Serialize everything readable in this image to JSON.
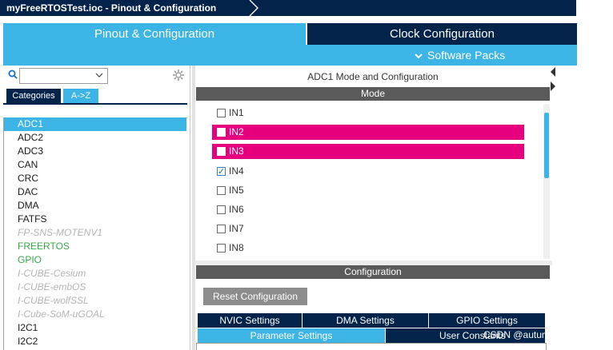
{
  "breadcrumb": {
    "text": "myFreeRTOSTest.ioc - Pinout & Configuration"
  },
  "tabs": {
    "pinout": "Pinout & Configuration",
    "clock": "Clock Configuration",
    "software_packs": "Software Packs"
  },
  "left": {
    "search": {
      "value": "",
      "placeholder": ""
    },
    "view_buttons": {
      "categories": "Categories",
      "az": "A->Z"
    },
    "items": [
      {
        "label": "ADC1",
        "state": "selected"
      },
      {
        "label": "ADC2",
        "state": "normal"
      },
      {
        "label": "ADC3",
        "state": "normal"
      },
      {
        "label": "CAN",
        "state": "normal"
      },
      {
        "label": "CRC",
        "state": "normal"
      },
      {
        "label": "DAC",
        "state": "normal"
      },
      {
        "label": "DMA",
        "state": "normal"
      },
      {
        "label": "FATFS",
        "state": "normal"
      },
      {
        "label": "FP-SNS-MOTENV1",
        "state": "disabled"
      },
      {
        "label": "FREERTOS",
        "state": "enabled"
      },
      {
        "label": "GPIO",
        "state": "enabled"
      },
      {
        "label": "I-CUBE-Cesium",
        "state": "disabled"
      },
      {
        "label": "I-CUBE-embOS",
        "state": "disabled"
      },
      {
        "label": "I-CUBE-wolfSSL",
        "state": "disabled"
      },
      {
        "label": "I-Cube-SoM-uGOAL",
        "state": "disabled"
      },
      {
        "label": "I2C1",
        "state": "normal"
      },
      {
        "label": "I2C2",
        "state": "normal"
      }
    ]
  },
  "mode": {
    "title": "ADC1 Mode and Configuration",
    "section": "Mode",
    "inputs": [
      {
        "label": "IN1",
        "checked": false,
        "highlighted": false
      },
      {
        "label": "IN2",
        "checked": false,
        "highlighted": true
      },
      {
        "label": "IN3",
        "checked": false,
        "highlighted": true
      },
      {
        "label": "IN4",
        "checked": true,
        "highlighted": false
      },
      {
        "label": "IN5",
        "checked": false,
        "highlighted": false
      },
      {
        "label": "IN6",
        "checked": false,
        "highlighted": false
      },
      {
        "label": "IN7",
        "checked": false,
        "highlighted": false
      },
      {
        "label": "IN8",
        "checked": false,
        "highlighted": false
      }
    ]
  },
  "config": {
    "section": "Configuration",
    "reset_label": "Reset Configuration",
    "tabs_row1": [
      "NVIC Settings",
      "DMA Settings",
      "GPIO Settings"
    ],
    "tabs_row2": [
      "Parameter Settings",
      "User Constants"
    ]
  },
  "watermark": "CSDN @autumn_qyh",
  "colors": {
    "navy": "#03234b",
    "st_blue": "#3cb4e6",
    "pink_highlight": "#e6007e",
    "enabled_green": "#3aa64a",
    "disabled_grey": "#b4b4b4"
  }
}
